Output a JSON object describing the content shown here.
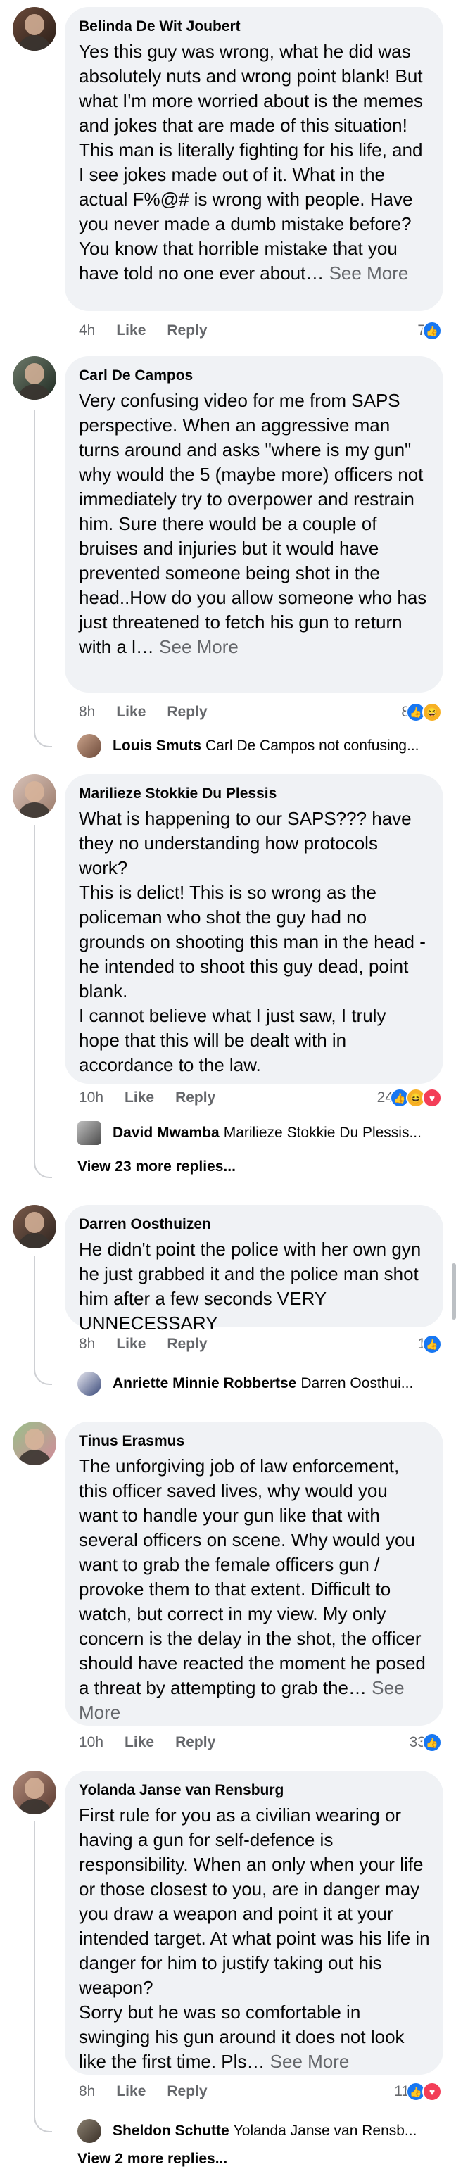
{
  "actions": {
    "like": "Like",
    "reply": "Reply"
  },
  "comments": [
    {
      "author": "Belinda De Wit Joubert",
      "text": "Yes this guy was wrong, what he did was absolutely nuts and wrong point blank! But what I'm more worried about is the memes and jokes that are made of this situation! This man is literally fighting for his life, and I see jokes made out of it. What in the actual F%@# is wrong with people. Have you never made a dumb mistake before? You know that horrible mistake that you have told no one ever about…",
      "see_more": "See More",
      "time": "4h",
      "reaction_count": "7",
      "reaction_icons": [
        "like-icon"
      ]
    },
    {
      "author": "Carl De Campos",
      "text": "Very confusing video for me from SAPS perspective. When an aggressive man turns around and asks \"where is my gun\" why would the 5 (maybe more) officers not immediately try to overpower and restrain him. Sure there would be a couple of bruises and injuries but it would have prevented someone being shot in the head..How do you allow someone who has just threatened to fetch his gun to return with a l…",
      "see_more": "See More",
      "time": "8h",
      "reaction_count": "8",
      "reaction_icons": [
        "like-icon",
        "haha-icon"
      ],
      "reply_preview": {
        "name": "Louis Smuts",
        "text": "Carl De Campos not confusing..."
      }
    },
    {
      "author": "Marilieze Stokkie Du Plessis",
      "text": "What is happening to our SAPS??? have they no understanding how protocols work?\nThis is delict! This is so wrong as the policeman who shot the guy had no grounds on shooting this man in the head - he intended to shoot this guy dead, point blank.\nI cannot believe what I just saw, I truly hope that this will be dealt with in accordance to the law.",
      "see_more": "",
      "time": "10h",
      "reaction_count": "24",
      "reaction_icons": [
        "like-icon",
        "haha-icon",
        "love-icon"
      ],
      "reply_preview": {
        "name": "David Mwamba",
        "text": "Marilieze Stokkie Du Plessis..."
      },
      "more_replies": "View 23 more replies..."
    },
    {
      "author": "Darren Oosthuizen",
      "text": "He didn't point the police with her own gyn he just grabbed it and the police man shot him after a few seconds VERY UNNECESSARY",
      "see_more": "",
      "time": "8h",
      "reaction_count": "1",
      "reaction_icons": [
        "like-icon"
      ],
      "reply_preview": {
        "name": "Anriette Minnie Robbertse",
        "text": "Darren Oosthui..."
      }
    },
    {
      "author": "Tinus Erasmus",
      "text": "The unforgiving job of law enforcement, this officer saved lives, why would you want to handle your gun like that with several officers on scene. Why would you want to grab the female officers gun / provoke them to that extent. Difficult to watch, but correct in my view. My only concern is the delay in the shot, the officer should have reacted the moment he posed a threat by attempting to grab the…",
      "see_more": "See More",
      "time": "10h",
      "reaction_count": "33",
      "reaction_icons": [
        "like-icon"
      ]
    },
    {
      "author": "Yolanda Janse van Rensburg",
      "text": "First rule for you as a civilian wearing or having a gun for self-defence is responsibility. When an only when your life or those closest to you, are in danger may you draw a weapon and point it at your intended target. At what point was his life in danger for him to justify taking out his weapon?\nSorry but he was so comfortable in swinging his gun around it does not look like the first time. Pls…",
      "see_more": "See More",
      "time": "8h",
      "reaction_count": "11",
      "reaction_icons": [
        "like-icon",
        "love-icon"
      ],
      "reply_preview": {
        "name": "Sheldon Schutte",
        "text": "Yolanda Janse van Rensb..."
      },
      "more_replies": "View 2 more replies..."
    }
  ],
  "colors": {
    "bubble": "#f0f2f5",
    "secondary_text": "#65676b",
    "like": "#1877f2",
    "love": "#f33e58",
    "haha": "#f7b125"
  }
}
